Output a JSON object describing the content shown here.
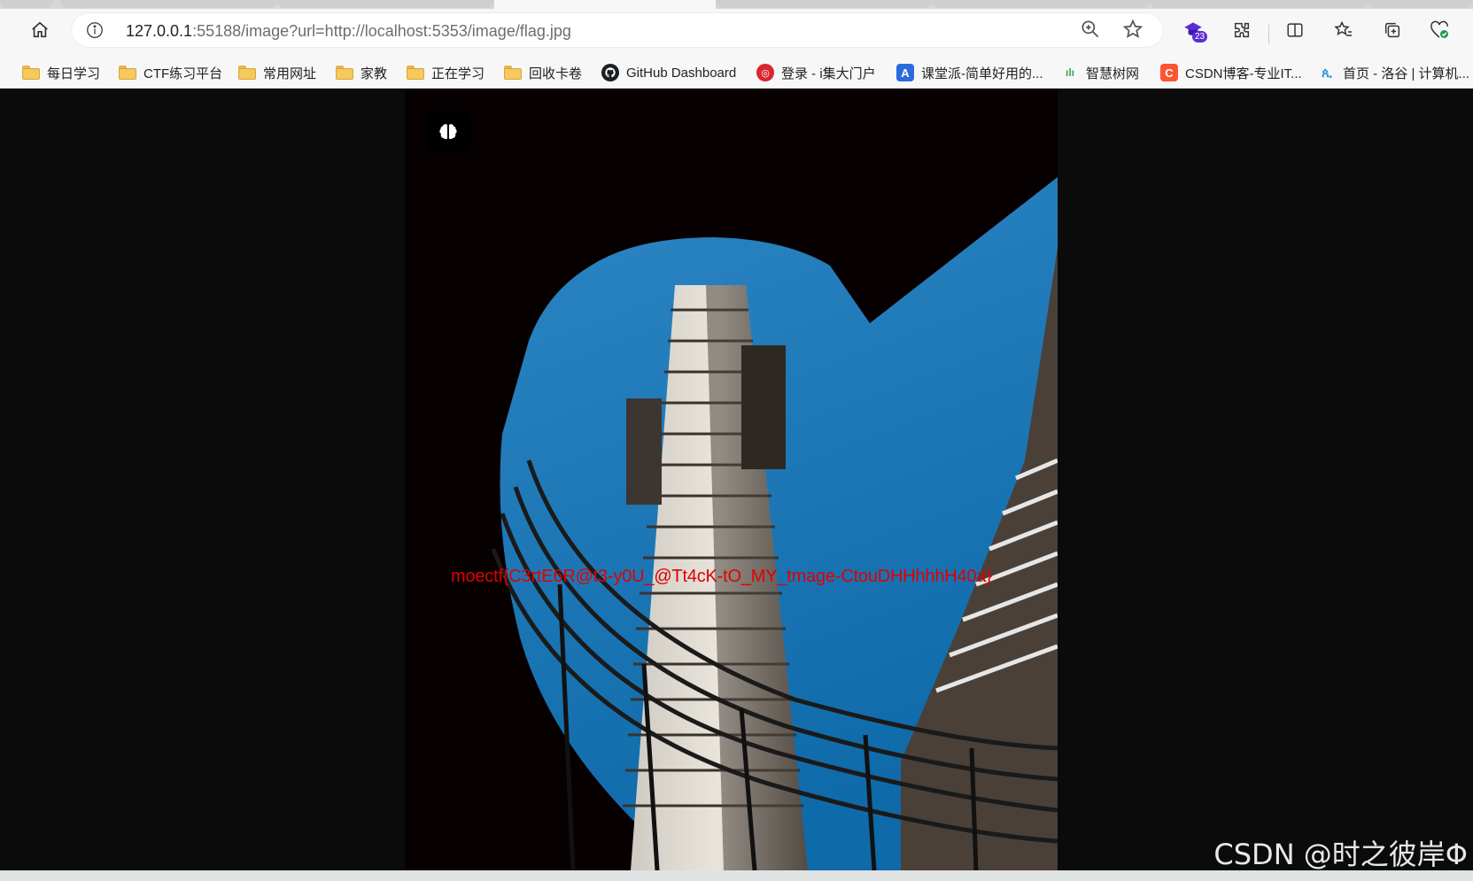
{
  "browser": {
    "url_host": "127.0.0.1",
    "url_rest": ":55188/image?url=http://localhost:5353/image/flag.jpg",
    "extension_badge": "23"
  },
  "bookmarks": [
    {
      "label": "每日学习",
      "icon": "folder-icon"
    },
    {
      "label": "CTF练习平台",
      "icon": "folder-icon"
    },
    {
      "label": "常用网址",
      "icon": "folder-icon"
    },
    {
      "label": "家教",
      "icon": "folder-icon"
    },
    {
      "label": "正在学习",
      "icon": "folder-icon"
    },
    {
      "label": "回收卡卷",
      "icon": "folder-icon"
    },
    {
      "label": "GitHub Dashboard",
      "icon": "github-icon"
    },
    {
      "label": "登录 - i集大门户",
      "icon": "jmu-icon"
    },
    {
      "label": "课堂派-简单好用的...",
      "icon": "ketangpai-icon"
    },
    {
      "label": "智慧树网",
      "icon": "zhihuishu-icon"
    },
    {
      "label": "CSDN博客-专业IT...",
      "icon": "csdn-icon"
    },
    {
      "label": "首页 - 洛谷 | 计算机...",
      "icon": "luogu-icon"
    }
  ],
  "image": {
    "overlay_text": "moectf{C3rtE6R@t3-y0U_@Tt4cK-tO_MY_tmage-CtouDHHhhhH40a}",
    "brain_icon": "brain-icon"
  },
  "watermark": "CSDN @时之彼岸Φ"
}
